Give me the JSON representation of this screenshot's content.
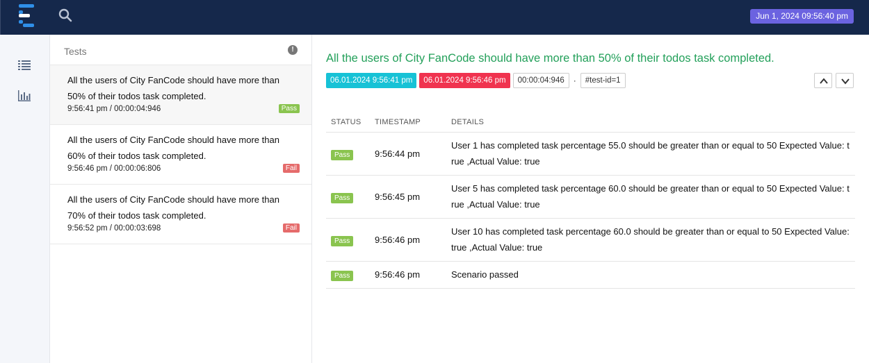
{
  "topbar": {
    "date": "Jun 1, 2024 09:56:40 pm",
    "icons": [
      "logo-icon",
      "search-icon"
    ]
  },
  "rail": {
    "icons": [
      "list-icon",
      "bar-chart-icon"
    ]
  },
  "tests_panel": {
    "title": "Tests",
    "items": [
      {
        "name": "All the users of City FanCode should have more than 50% of their todos task completed.",
        "meta": "9:56:41 pm / 00:00:04:946",
        "status": "Pass"
      },
      {
        "name": "All the users of City FanCode should have more than 60% of their todos task completed.",
        "meta": "9:56:46 pm / 00:00:06:806",
        "status": "Fail"
      },
      {
        "name": "All the users of City FanCode should have more than 70% of their todos task completed.",
        "meta": "9:56:52 pm / 00:00:03:698",
        "status": "Fail"
      }
    ]
  },
  "detail": {
    "title": "All the users of City FanCode should have more than 50% of their todos task completed.",
    "start": "06.01.2024 9:56:41 pm",
    "end": "06.01.2024 9:56:46 pm",
    "duration": "00:00:04:946",
    "separator": "·",
    "test_id": "#test-id=1",
    "columns": {
      "status": "STATUS",
      "timestamp": "TIMESTAMP",
      "details": "DETAILS"
    },
    "logs": [
      {
        "status": "Pass",
        "time": "9:56:44 pm",
        "details": "User 1 has completed task percentage 55.0 should be greater than or equal to 50 Expected Value: true ,Actual Value: true"
      },
      {
        "status": "Pass",
        "time": "9:56:45 pm",
        "details": "User 5 has completed task percentage 60.0 should be greater than or equal to 50 Expected Value: true ,Actual Value: true"
      },
      {
        "status": "Pass",
        "time": "9:56:46 pm",
        "details": "User 10 has completed task percentage 60.0 should be greater than or equal to 50 Expected Value: true ,Actual Value: true"
      },
      {
        "status": "Pass",
        "time": "9:56:46 pm",
        "details": "Scenario passed"
      }
    ]
  },
  "colors": {
    "topbar": "#15284b",
    "date_badge": "#6b63e0",
    "title_green": "#23a05a",
    "pass": "#8ac44f",
    "fail": "#e56b6b",
    "start_chip": "#17c2d6",
    "end_chip": "#f0334f"
  }
}
